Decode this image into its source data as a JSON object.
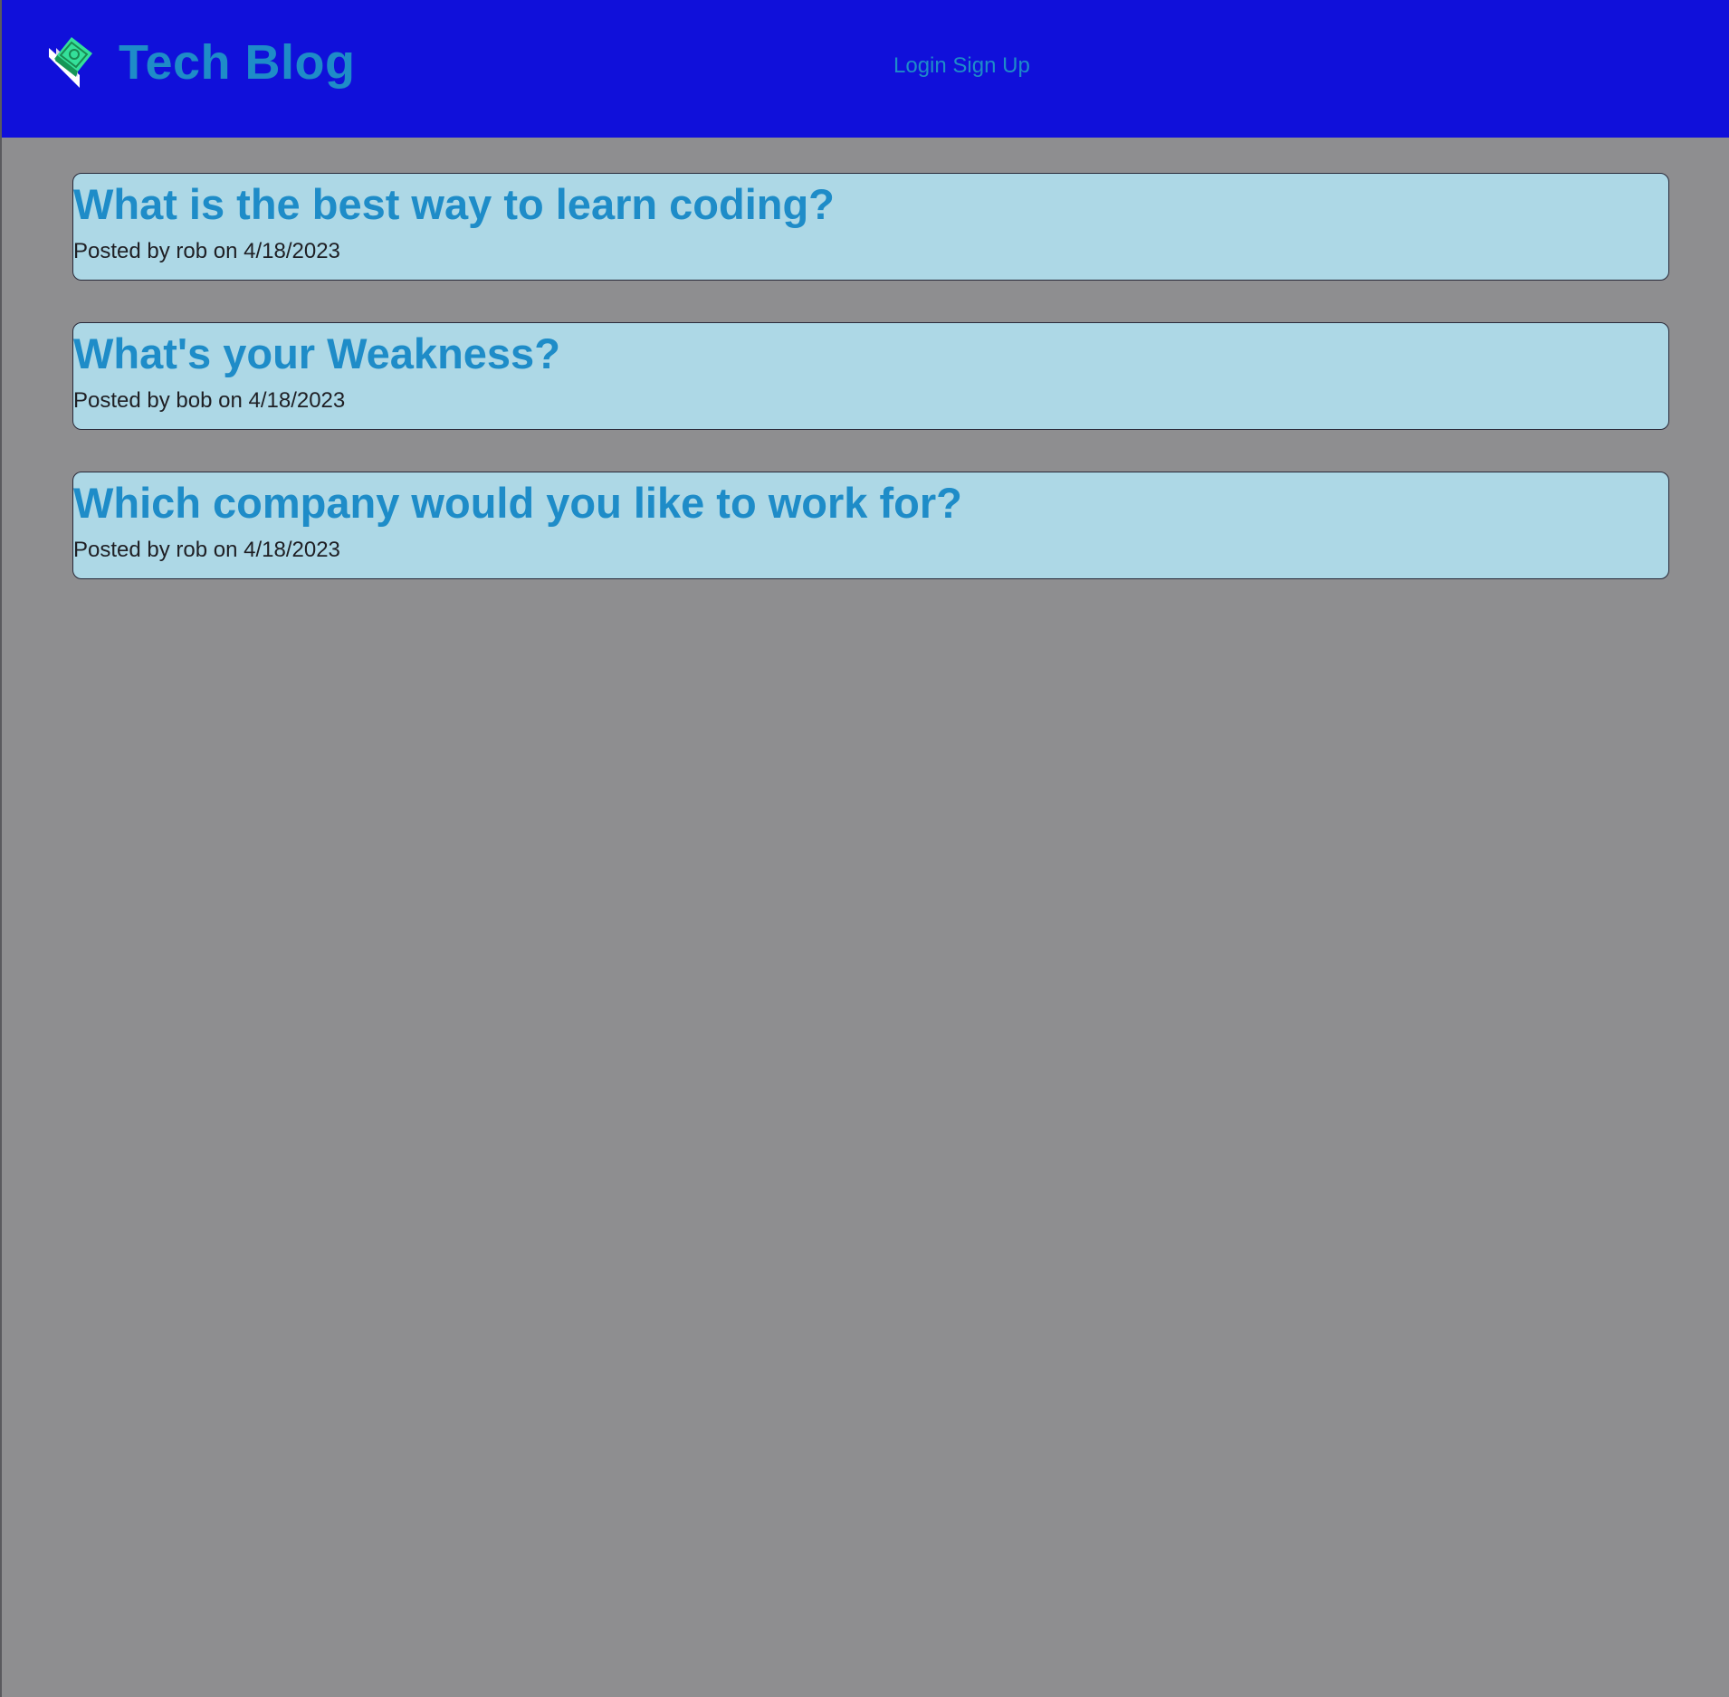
{
  "header": {
    "title": "Tech Blog",
    "logo_icon": "money-bill-icon",
    "nav": {
      "login_label": "Login",
      "signup_label": "Sign Up"
    },
    "background_color": "#1010da",
    "title_color": "#1e8cc8"
  },
  "posts": [
    {
      "title": "What is the best way to learn coding?",
      "meta": "Posted by rob on 4/18/2023"
    },
    {
      "title": "What's your Weakness?",
      "meta": "Posted by bob on 4/18/2023"
    },
    {
      "title": "Which company would you like to work for?",
      "meta": "Posted by rob on 4/18/2023"
    }
  ],
  "colors": {
    "page_background": "#8e8e90",
    "card_background": "#add8e6"
  }
}
